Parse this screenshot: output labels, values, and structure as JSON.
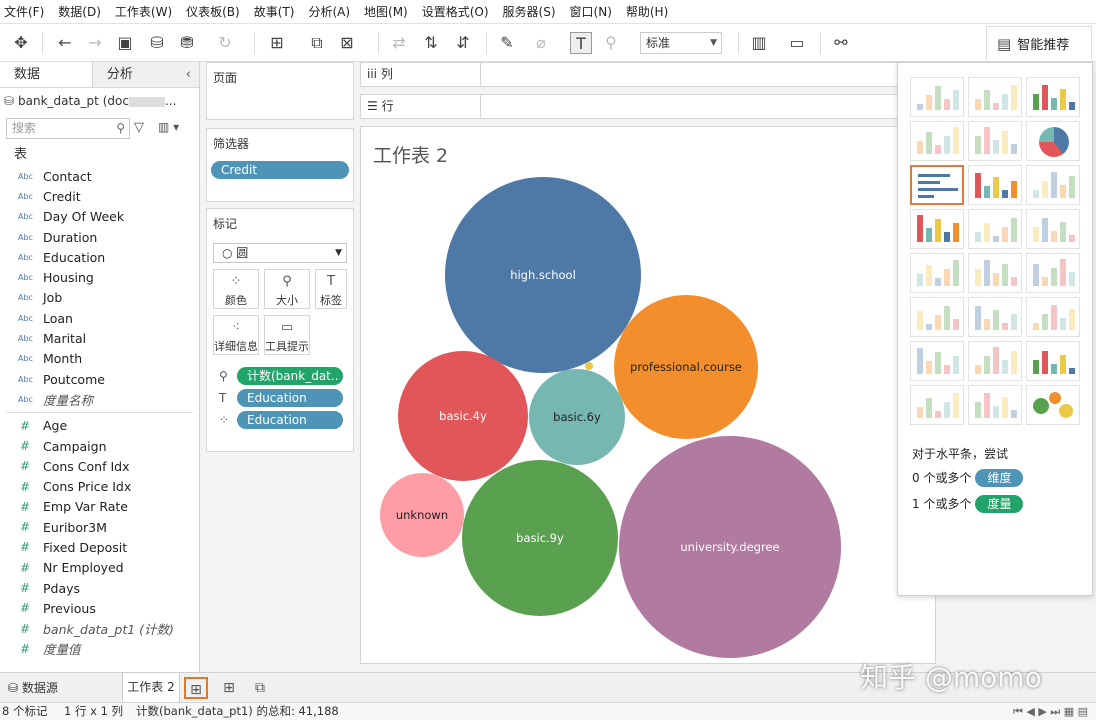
{
  "menu": [
    "文件(F)",
    "数据(D)",
    "工作表(W)",
    "仪表板(B)",
    "故事(T)",
    "分析(A)",
    "地图(M)",
    "设置格式(O)",
    "服务器(S)",
    "窗口(N)",
    "帮助(H)"
  ],
  "toolbar": {
    "fit_select": "标准",
    "smart_recommend": "智能推荐"
  },
  "left": {
    "tab_data": "数据",
    "tab_analysis": "分析",
    "datasource": "bank_data_pt (doc",
    "datasource_tail": "...",
    "search_placeholder": "搜索",
    "section_tables": "表",
    "dimensions": [
      "Contact",
      "Credit",
      "Day Of Week",
      "Duration",
      "Education",
      "Housing",
      "Job",
      "Loan",
      "Marital",
      "Month",
      "Poutcome"
    ],
    "dim_measure_names": "度量名称",
    "measures": [
      "Age",
      "Campaign",
      "Cons Conf Idx",
      "Cons Price Idx",
      "Emp Var Rate",
      "Euribor3M",
      "Fixed Deposit",
      "Nr Employed",
      "Pdays",
      "Previous"
    ],
    "measure_count": "bank_data_pt1 (计数)",
    "measure_values": "度量值"
  },
  "shelves": {
    "pages": "页面",
    "filters": "筛选器",
    "filter_pill": "Credit",
    "marks": "标记",
    "marks_type": "圆",
    "btn_color": "颜色",
    "btn_size": "大小",
    "btn_label": "标签",
    "btn_detail": "详细信息",
    "btn_tooltip": "工具提示",
    "size_pill": "计数(bank_dat..",
    "label_pill": "Education",
    "color_pill": "Education",
    "columns": "列",
    "rows": "行"
  },
  "worksheet": {
    "title": "工作表 2"
  },
  "chart_data": {
    "type": "bubble",
    "bubbles": [
      {
        "label": "university.degree",
        "color": "#b07aa1"
      },
      {
        "label": "high.school",
        "color": "#4e79a7"
      },
      {
        "label": "basic.9y",
        "color": "#59a14f"
      },
      {
        "label": "professional.course",
        "color": "#f28e2b"
      },
      {
        "label": "basic.4y",
        "color": "#e15759"
      },
      {
        "label": "basic.6y",
        "color": "#76b7b2"
      },
      {
        "label": "unknown",
        "color": "#ff9da7"
      },
      {
        "label": "",
        "color": "#edc948"
      }
    ]
  },
  "showme": {
    "hint": "对于水平条，尝试",
    "dim_prefix": "0 个或多个",
    "dim_badge": "维度",
    "mea_prefix": "1 个或多个",
    "mea_badge": "度量"
  },
  "bottom": {
    "datasource_tab": "数据源",
    "sheet_tab": "工作表 2",
    "watermark": "知乎 @momo"
  },
  "status": {
    "marks": "8 个标记",
    "rowscols": "1 行 x 1 列",
    "sum": "计数(bank_data_pt1) 的总和: 41,188"
  }
}
